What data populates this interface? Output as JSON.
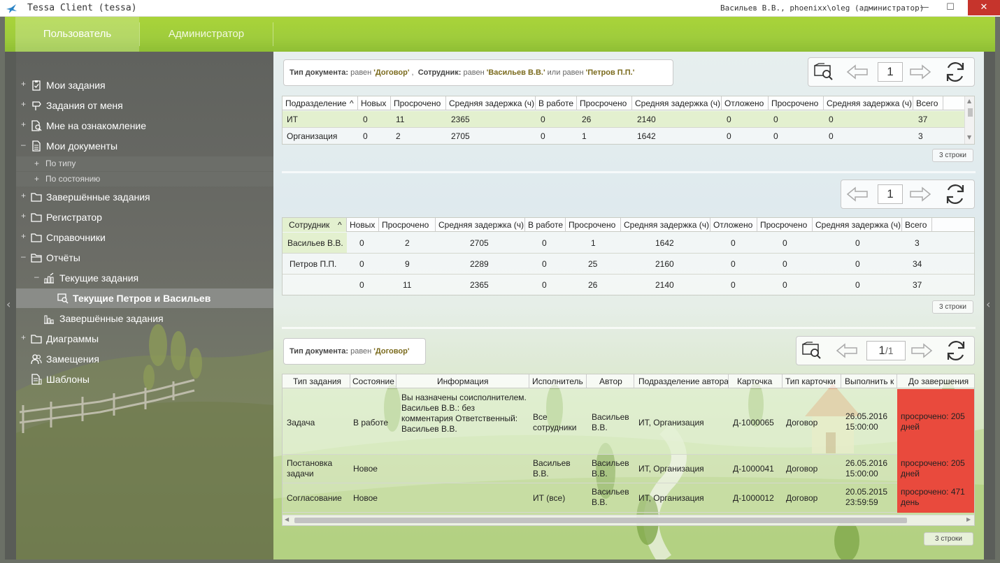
{
  "window": {
    "title": "Tessa Client (tessa)",
    "user": "Васильев В.В., phoenixx\\oleg (администратор)",
    "min": "—",
    "max": "☐",
    "close": "✕"
  },
  "topnav": {
    "tab_user": "Пользователь",
    "tab_admin": "Администратор"
  },
  "sidebar": {
    "items": [
      {
        "label": "Мои задания",
        "pm": "+"
      },
      {
        "label": "Задания от меня",
        "pm": "+"
      },
      {
        "label": "Мне на ознакомление",
        "pm": "+"
      },
      {
        "label": "Мои документы",
        "pm": "–"
      },
      {
        "label": "По типу",
        "pm": "+"
      },
      {
        "label": "По состоянию",
        "pm": "+"
      },
      {
        "label": "Завершённые задания",
        "pm": "+"
      },
      {
        "label": "Регистратор",
        "pm": "+"
      },
      {
        "label": "Справочники",
        "pm": "+"
      },
      {
        "label": "Отчёты",
        "pm": "–"
      },
      {
        "label": "Текущие задания",
        "pm": "–"
      },
      {
        "label": "Текущие Петров и Васильев",
        "pm": ""
      },
      {
        "label": "Завершённые задания",
        "pm": ""
      },
      {
        "label": "Диаграммы",
        "pm": "+"
      },
      {
        "label": "Замещения",
        "pm": ""
      },
      {
        "label": "Шаблоны",
        "pm": ""
      }
    ]
  },
  "filter1": {
    "k1": "Тип документа:",
    "op1": "равен",
    "v1": "'Договор'",
    "comma": ",",
    "k2": "Сотрудник:",
    "op2": "равен",
    "v2": "'Васильев В.В.'",
    "or": "или",
    "op3": "равен",
    "v3": "'Петров П.П.'"
  },
  "pager1": {
    "page": "1"
  },
  "grid1": {
    "columns": [
      "Подразделение",
      "Новых",
      "Просрочено",
      "Средняя задержка (ч)",
      "В работе",
      "Просрочено",
      "Средняя задержка (ч)",
      "Отложено",
      "Просрочено",
      "Средняя задержка (ч)",
      "Всего"
    ],
    "sort_arrow": "^",
    "rows": [
      [
        "ИТ",
        "0",
        "11",
        "2365",
        "0",
        "26",
        "2140",
        "0",
        "0",
        "0",
        "37"
      ],
      [
        "Организация",
        "0",
        "2",
        "2705",
        "0",
        "1",
        "1642",
        "0",
        "0",
        "0",
        "3"
      ]
    ],
    "rows_label": "3 строки"
  },
  "pager2": {
    "page": "1"
  },
  "grid2": {
    "columns": [
      "Сотрудник",
      "Новых",
      "Просрочено",
      "Средняя задержка (ч)",
      "В работе",
      "Просрочено",
      "Средняя задержка (ч)",
      "Отложено",
      "Просрочено",
      "Средняя задержка (ч)",
      "Всего"
    ],
    "sort_arrow": "^",
    "rows": [
      [
        "Васильев В.В.",
        "0",
        "2",
        "2705",
        "0",
        "1",
        "1642",
        "0",
        "0",
        "0",
        "3"
      ],
      [
        "Петров П.П.",
        "0",
        "9",
        "2289",
        "0",
        "25",
        "2160",
        "0",
        "0",
        "0",
        "34"
      ],
      [
        "",
        "0",
        "11",
        "2365",
        "0",
        "26",
        "2140",
        "0",
        "0",
        "0",
        "37"
      ]
    ],
    "rows_label": "3 строки"
  },
  "filter3": {
    "k1": "Тип документа:",
    "op1": "равен",
    "v1": "'Договор'"
  },
  "pager3": {
    "page": "1",
    "total": "1",
    "slash": "/"
  },
  "grid3": {
    "columns": [
      "Тип задания",
      "Состояние",
      "Информация",
      "Исполнитель",
      "Автор",
      "Подразделение автора",
      "Карточка",
      "Тип карточки",
      "Выполнить к",
      "До завершения"
    ],
    "rows": [
      [
        "Задача",
        "В работе",
        "Вы назначены соисполнителем. Васильев В.В.: без комментария Ответственный: Васильев В.В.",
        "Все сотрудники",
        "Васильев В.В.",
        "ИТ, Организация",
        "Д-1000065",
        "Договор",
        "26.05.2016 15:00:00",
        "просрочено: 205 дней"
      ],
      [
        "Постановка задачи",
        "Новое",
        "",
        "Васильев В.В.",
        "Васильев В.В.",
        "ИТ, Организация",
        "Д-1000041",
        "Договор",
        "26.05.2016 15:00:00",
        "просрочено: 205 дней"
      ],
      [
        "Согласование",
        "Новое",
        "",
        "ИТ (все)",
        "Васильев В.В.",
        "ИТ, Организация",
        "Д-1000012",
        "Договор",
        "20.05.2015 23:59:59",
        "просрочено: 471 день"
      ]
    ],
    "rows_label": "3 строки"
  },
  "colors": {
    "accent": "#9fcc3c",
    "overdue": "#e94a3d",
    "selected_row": "#e7f3d3"
  }
}
